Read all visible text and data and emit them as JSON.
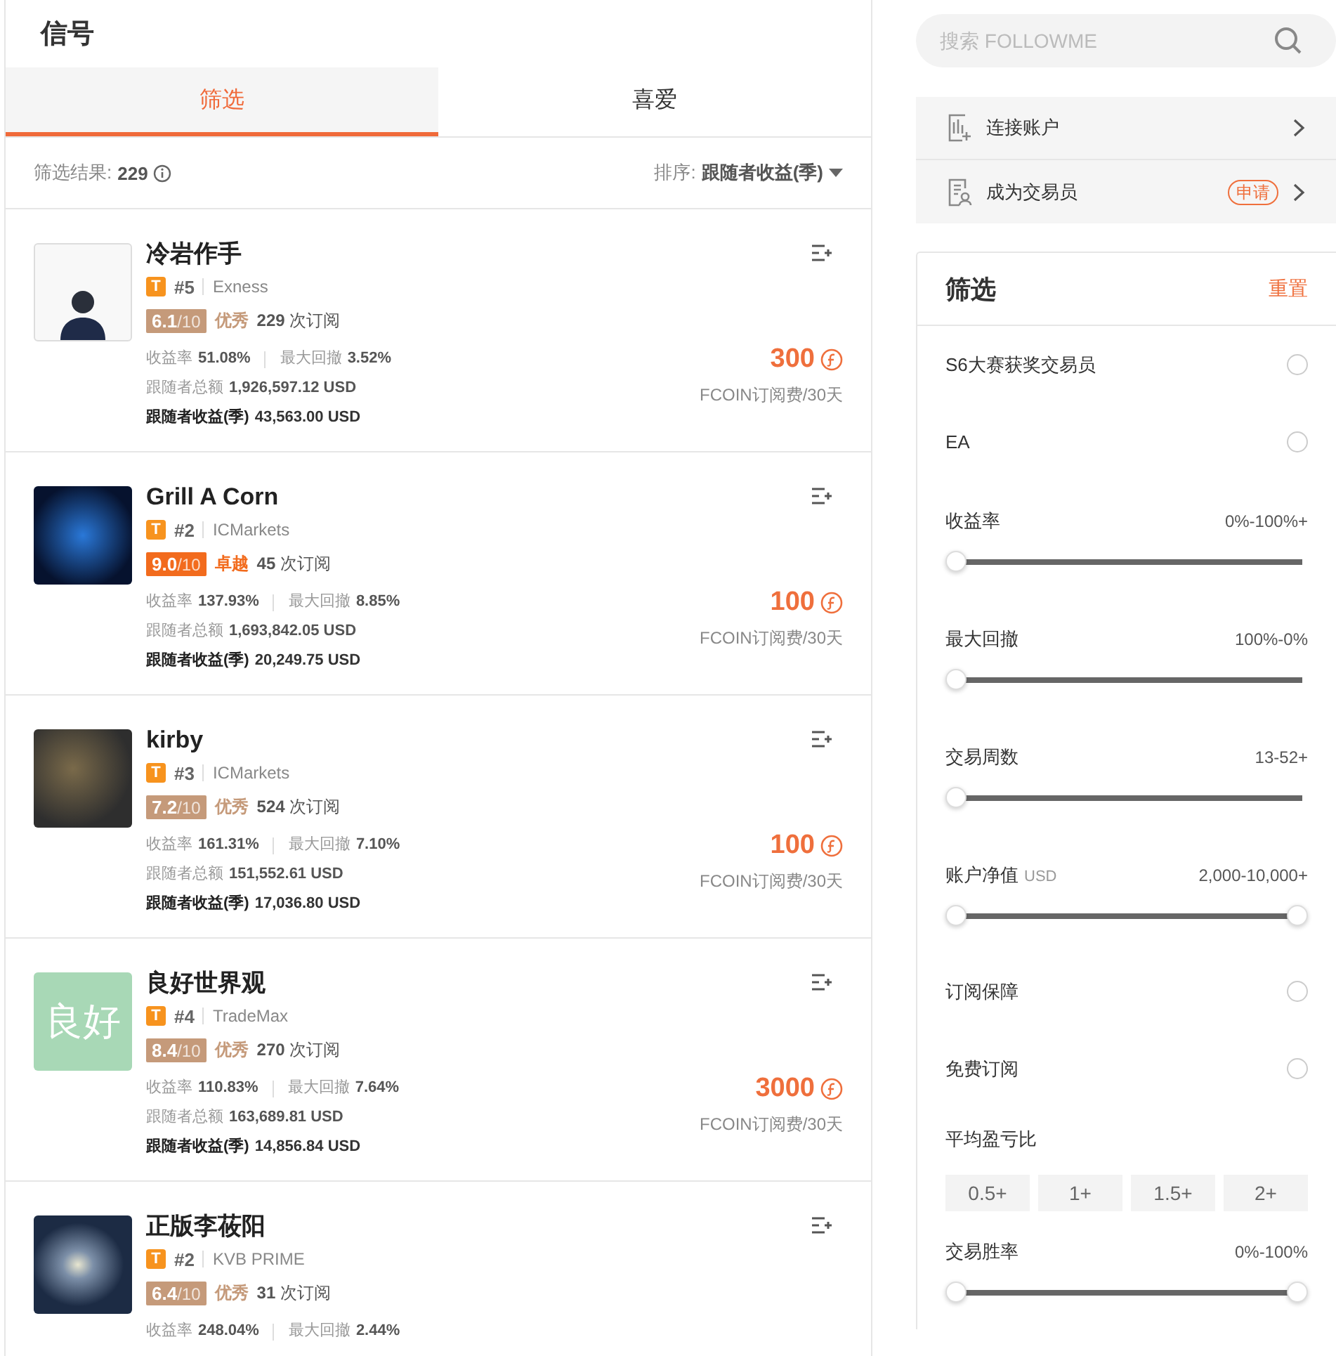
{
  "header": {
    "title": "信号"
  },
  "tabs": [
    {
      "label": "筛选",
      "selected": true
    },
    {
      "label": "喜爱",
      "selected": false
    }
  ],
  "results": {
    "label": "筛选结果:",
    "count": "229",
    "sort_label": "排序:",
    "sort_value": "跟随者收益(季)"
  },
  "signals": [
    {
      "name": "冷岩作手",
      "avatar": {
        "kind": "photo"
      },
      "type_badge": "T",
      "rank": "#5",
      "broker": "Exness",
      "score": "6.1",
      "scale": "/10",
      "tier": "优秀",
      "color": "#c59a7a",
      "subscriptions": "229",
      "subs_label": "次订阅",
      "stats": [
        {
          "label": "收益率",
          "value": "51.08%"
        },
        {
          "label": "最大回撤",
          "value": "3.52%"
        }
      ],
      "followers_total": {
        "label": "跟随者总额",
        "value": "1,926,597.12 USD"
      },
      "follower_profit": {
        "label": "跟随者收益(季)",
        "value": "43,563.00 USD"
      },
      "price": "300",
      "fee_label": "FCOIN订阅费/30天"
    },
    {
      "name": "Grill A Corn",
      "avatar": {
        "kind": "eye"
      },
      "type_badge": "T",
      "rank": "#2",
      "broker": "ICMarkets",
      "score": "9.0",
      "scale": "/10",
      "tier": "卓越",
      "color": "#f26b1d",
      "subscriptions": "45",
      "subs_label": "次订阅",
      "stats": [
        {
          "label": "收益率",
          "value": "137.93%"
        },
        {
          "label": "最大回撤",
          "value": "8.85%"
        }
      ],
      "followers_total": {
        "label": "跟随者总额",
        "value": "1,693,842.05 USD"
      },
      "follower_profit": {
        "label": "跟随者收益(季)",
        "value": "20,249.75 USD"
      },
      "price": "100",
      "fee_label": "FCOIN订阅费/30天"
    },
    {
      "name": "kirby",
      "avatar": {
        "kind": "gold"
      },
      "type_badge": "T",
      "rank": "#3",
      "broker": "ICMarkets",
      "score": "7.2",
      "scale": "/10",
      "tier": "优秀",
      "color": "#c59a7a",
      "subscriptions": "524",
      "subs_label": "次订阅",
      "stats": [
        {
          "label": "收益率",
          "value": "161.31%"
        },
        {
          "label": "最大回撤",
          "value": "7.10%"
        }
      ],
      "followers_total": {
        "label": "跟随者总额",
        "value": "151,552.61 USD"
      },
      "follower_profit": {
        "label": "跟随者收益(季)",
        "value": "17,036.80 USD"
      },
      "price": "100",
      "fee_label": "FCOIN订阅费/30天"
    },
    {
      "name": "良好世界观",
      "avatar": {
        "kind": "text",
        "text": "良好"
      },
      "type_badge": "T",
      "rank": "#4",
      "broker": "TradeMax",
      "score": "8.4",
      "scale": "/10",
      "tier": "优秀",
      "color": "#c59a7a",
      "subscriptions": "270",
      "subs_label": "次订阅",
      "stats": [
        {
          "label": "收益率",
          "value": "110.83%"
        },
        {
          "label": "最大回撤",
          "value": "7.64%"
        }
      ],
      "followers_total": {
        "label": "跟随者总额",
        "value": "163,689.81 USD"
      },
      "follower_profit": {
        "label": "跟随者收益(季)",
        "value": "14,856.84 USD"
      },
      "price": "3000",
      "fee_label": "FCOIN订阅费/30天"
    },
    {
      "name": "正版李莜阳",
      "avatar": {
        "kind": "galaxy"
      },
      "type_badge": "T",
      "rank": "#2",
      "broker": "KVB PRIME",
      "score": "6.4",
      "scale": "/10",
      "tier": "优秀",
      "color": "#c59a7a",
      "subscriptions": "31",
      "subs_label": "次订阅",
      "stats": [
        {
          "label": "收益率",
          "value": "248.04%"
        },
        {
          "label": "最大回撤",
          "value": "2.44%"
        }
      ]
    }
  ],
  "search": {
    "placeholder": "搜索 FOLLOWME"
  },
  "menu": [
    {
      "label": "连接账户",
      "kind": "connect"
    },
    {
      "label": "成为交易员",
      "kind": "trader",
      "badge": "申请"
    }
  ],
  "filter": {
    "title": "筛选",
    "reset": "重置",
    "items": [
      {
        "kind": "check",
        "label": "S6大赛获奖交易员",
        "checked": false
      },
      {
        "kind": "check",
        "label": "EA",
        "checked": false
      },
      {
        "kind": "slider",
        "label": "收益率",
        "range": "0%-100%+",
        "level": 0
      },
      {
        "kind": "slider",
        "label": "最大回撤",
        "range": "100%-0%",
        "level": 0
      },
      {
        "kind": "slider",
        "label": "交易周数",
        "range": "13-52+",
        "level": 0
      },
      {
        "kind": "range",
        "label": "账户净值",
        "unit": "USD",
        "range": "2,000-10,000+",
        "level": 0
      },
      {
        "kind": "check",
        "label": "订阅保障",
        "checked": false
      },
      {
        "kind": "check",
        "label": "免费订阅",
        "checked": false
      },
      {
        "kind": "options",
        "label": "平均盈亏比",
        "options": [
          {
            "label": "0.5+",
            "selected": false
          },
          {
            "label": "1+",
            "selected": false
          },
          {
            "label": "1.5+",
            "selected": false
          },
          {
            "label": "2+",
            "selected": false
          }
        ]
      },
      {
        "kind": "range",
        "label": "交易胜率",
        "range": "0%-100%",
        "level": 0
      }
    ]
  }
}
